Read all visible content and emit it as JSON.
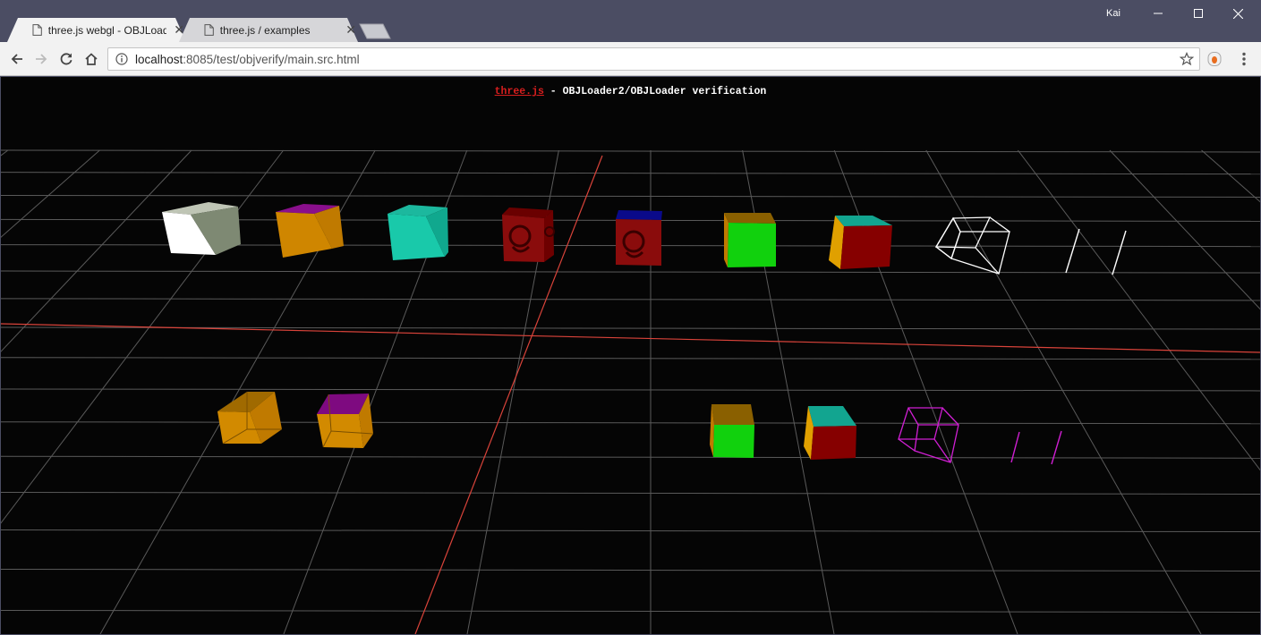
{
  "browser": {
    "tabs": [
      {
        "title": "three.js webgl - OBJLoad",
        "active": true
      },
      {
        "title": "three.js / examples",
        "active": false
      }
    ],
    "profile_name": "Kai",
    "url_host": "localhost",
    "url_rest": ":8085/test/objverify/main.src.html"
  },
  "page": {
    "link_text": "three.js",
    "heading_rest": " - OBJLoader2/OBJLoader verification"
  },
  "colors": {
    "link": "#d71e1e",
    "grid": "#5a5a5a",
    "axis": "#d9433a",
    "background": "#050505"
  }
}
